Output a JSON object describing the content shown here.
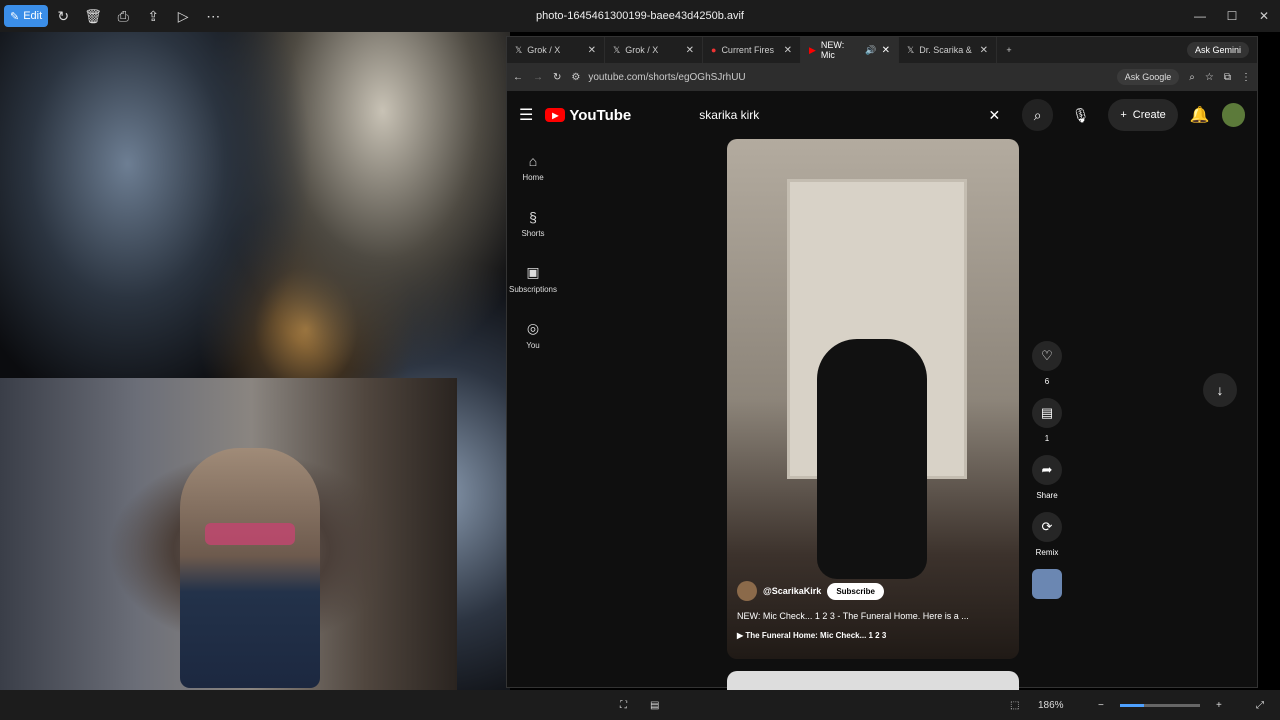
{
  "viewer": {
    "edit_label": "Edit",
    "title": "photo-1645461300199-baee43d4250b.avif",
    "zoom": "186%",
    "zoom_fraction": 0.3
  },
  "tabs": [
    {
      "label": "Grok / X"
    },
    {
      "label": "Grok / X"
    },
    {
      "label": "Current Fires"
    },
    {
      "label": "NEW: Mic"
    },
    {
      "label": "Dr. Scarika &"
    }
  ],
  "browser": {
    "ask_gemini": "Ask Gemini",
    "url": "youtube.com/shorts/egOGhSJrhUU",
    "ask_google": "Ask Google"
  },
  "youtube": {
    "logo": "YouTube",
    "search_value": "skarika kirk",
    "create": "Create",
    "sidebar": [
      {
        "label": "Home",
        "icon": "⌂"
      },
      {
        "label": "Shorts",
        "icon": "§"
      },
      {
        "label": "Subscriptions",
        "icon": "▣"
      },
      {
        "label": "You",
        "icon": "◎"
      }
    ],
    "channel": "@ScarikaKirk",
    "subscribe": "Subscribe",
    "video_title": "NEW: Mic Check... 1 2 3 - The Funeral Home. Here is a ...",
    "playlist": "The Funeral Home: Mic Check... 1 2 3",
    "actions": {
      "likes": "6",
      "comments": "1",
      "share": "Share",
      "remix": "Remix"
    }
  }
}
